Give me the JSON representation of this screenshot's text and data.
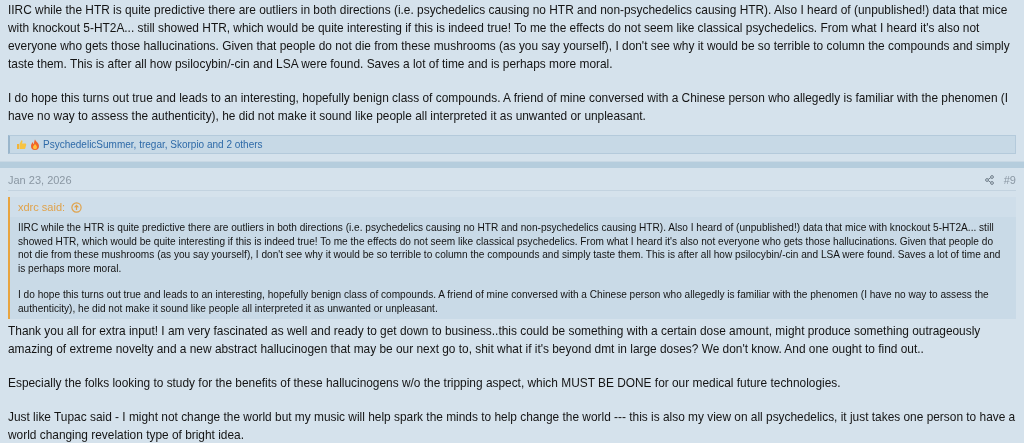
{
  "posts": [
    {
      "paragraphs": [
        "IIRC while the HTR is quite predictive there are outliers in both directions (i.e. psychedelics causing no HTR and non-psychedelics causing HTR). Also I heard of (unpublished!) data that mice with knockout 5-HT2A... still showed HTR, which would be quite interesting if this is indeed true! To me the effects do not seem like classical psychedelics. From what I heard it's also not everyone who gets those hallucinations. Given that people do not die from these mushrooms (as you say yourself), I don't see why it would be so terrible to column the compounds and simply taste them. This is after all how psilocybin/-cin and LSA were found. Saves a lot of time and is perhaps more moral.",
        "I do hope this turns out true and leads to an interesting, hopefully benign class of compounds. A friend of mine conversed with a Chinese person who allegedly is familiar with the phenomen (I have no way to assess the authenticity), he did not make it sound like people all interpreted it as unwanted or unpleasant."
      ],
      "reactions": "PsychedelicSummer, tregar, Skorpio and 2 others"
    },
    {
      "date": "Jan 23, 2026",
      "number": "#9",
      "quote": {
        "author": "xdrc said:",
        "paragraphs": [
          "IIRC while the HTR is quite predictive there are outliers in both directions (i.e. psychedelics causing no HTR and non-psychedelics causing HTR). Also I heard of (unpublished!) data that mice with knockout 5-HT2A... still showed HTR, which would be quite interesting if this is indeed true! To me the effects do not seem like classical psychedelics. From what I heard it's also not everyone who gets those hallucinations. Given that people do not die from these mushrooms (as you say yourself), I don't see why it would be so terrible to column the compounds and simply taste them. This is after all how psilocybin/-cin and LSA were found. Saves a lot of time and is perhaps more moral.",
          "I do hope this turns out true and leads to an interesting, hopefully benign class of compounds. A friend of mine conversed with a Chinese person who allegedly is familiar with the phenomen (I have no way to assess the authenticity), he did not make it sound like people all interpreted it as unwanted or unpleasant."
        ]
      },
      "paragraphs": [
        "Thank you all for extra input! I am very fascinated as well and ready to get down to business..this could be something with a certain dose amount, might produce something outrageously amazing of extreme novelty and a new abstract hallucinogen that may be our next go to, shit what if it's beyond dmt in large doses? We don't know. And one ought to find out..",
        "Especially the folks looking to study for the benefits of these hallucinogens w/o the tripping aspect, which MUST BE DONE for our medical future technologies.",
        "Just like Tupac said - I might not change the world but my music will help spark the minds to help change the world --- this is also my view on all psychedelics, it just takes one person to have a world changing revelation type of bright idea."
      ]
    }
  ]
}
